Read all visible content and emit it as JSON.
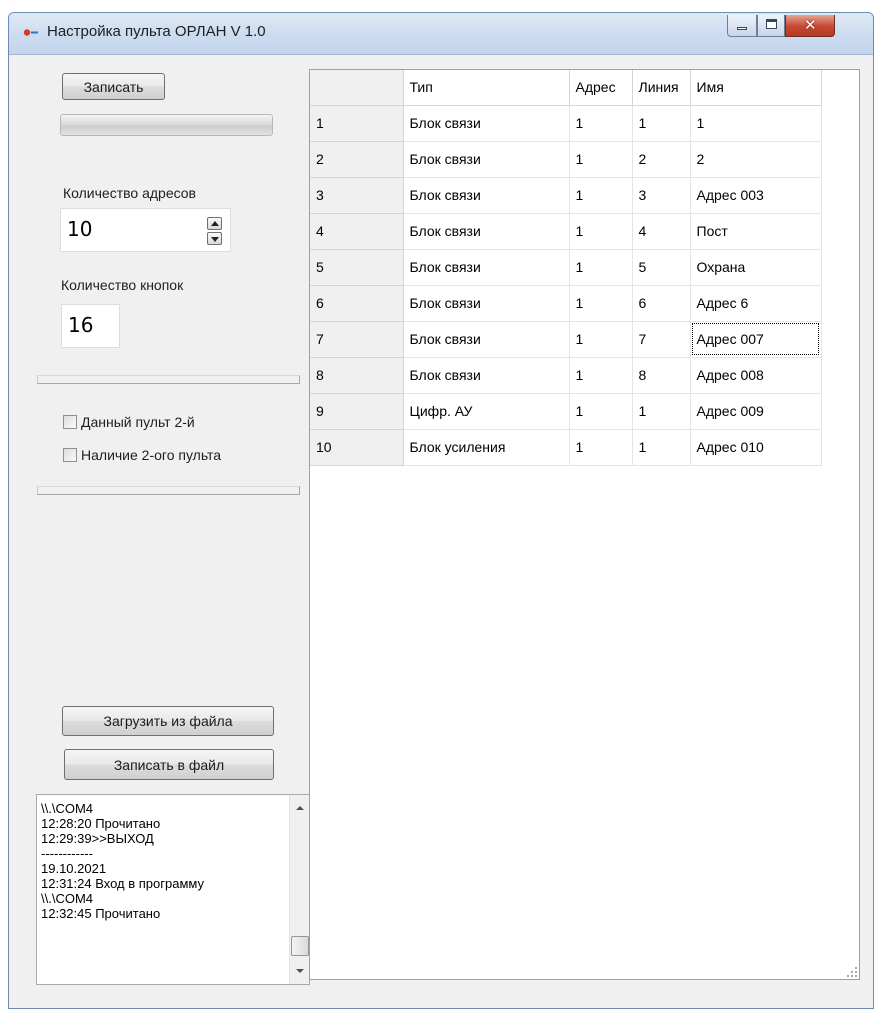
{
  "window": {
    "title": "Настройка пульта ОРЛАН V 1.0",
    "controls": {
      "minimize": "minimize",
      "maximize": "maximize",
      "close": "✕"
    }
  },
  "left_panel": {
    "write_button": "Записать",
    "progress_value": 0,
    "addresses_label": "Количество адресов",
    "addresses_value": "10",
    "buttons_label": "Количество кнопок",
    "buttons_value": "16",
    "checkbox_second_console": "Данный пульт 2-й",
    "checkbox_has_second": "Наличие 2-ого пульта",
    "load_button": "Загрузить из файла",
    "save_button": "Записать в файл"
  },
  "log": {
    "lines": [
      "\\\\.\\COM4",
      "12:28:20 Прочитано",
      "12:29:39>>ВЫХОД",
      "------------",
      "19.10.2021",
      "12:31:24 Вход в программу",
      "\\\\.\\COM4",
      "12:32:45 Прочитано"
    ]
  },
  "table": {
    "headers": [
      "",
      "Тип",
      "Адрес",
      "Линия",
      "Имя"
    ],
    "rows": [
      [
        "1",
        "Блок связи",
        "1",
        "1",
        "1"
      ],
      [
        "2",
        "Блок связи",
        "1",
        "2",
        "2"
      ],
      [
        "3",
        "Блок связи",
        "1",
        "3",
        "Адрес 003"
      ],
      [
        "4",
        "Блок связи",
        "1",
        "4",
        "Пост"
      ],
      [
        "5",
        "Блок связи",
        "1",
        "5",
        "Охрана"
      ],
      [
        "6",
        "Блок связи",
        "1",
        "6",
        "Адрес 6"
      ],
      [
        "7",
        "Блок связи",
        "1",
        "7",
        "Адрес 007"
      ],
      [
        "8",
        "Блок связи",
        "1",
        "8",
        "Адрес 008"
      ],
      [
        "9",
        "Цифр. АУ",
        "1",
        "1",
        "Адрес 009"
      ],
      [
        "10",
        "Блок усиления",
        "1",
        "1",
        "Адрес 010"
      ]
    ],
    "focused_cell": "7:4"
  },
  "colors": {
    "window_bg": "#f0f0f0",
    "titlebar": "#cdddf0",
    "close_button": "#c5472f",
    "grid_line": "#e5e5e5"
  }
}
